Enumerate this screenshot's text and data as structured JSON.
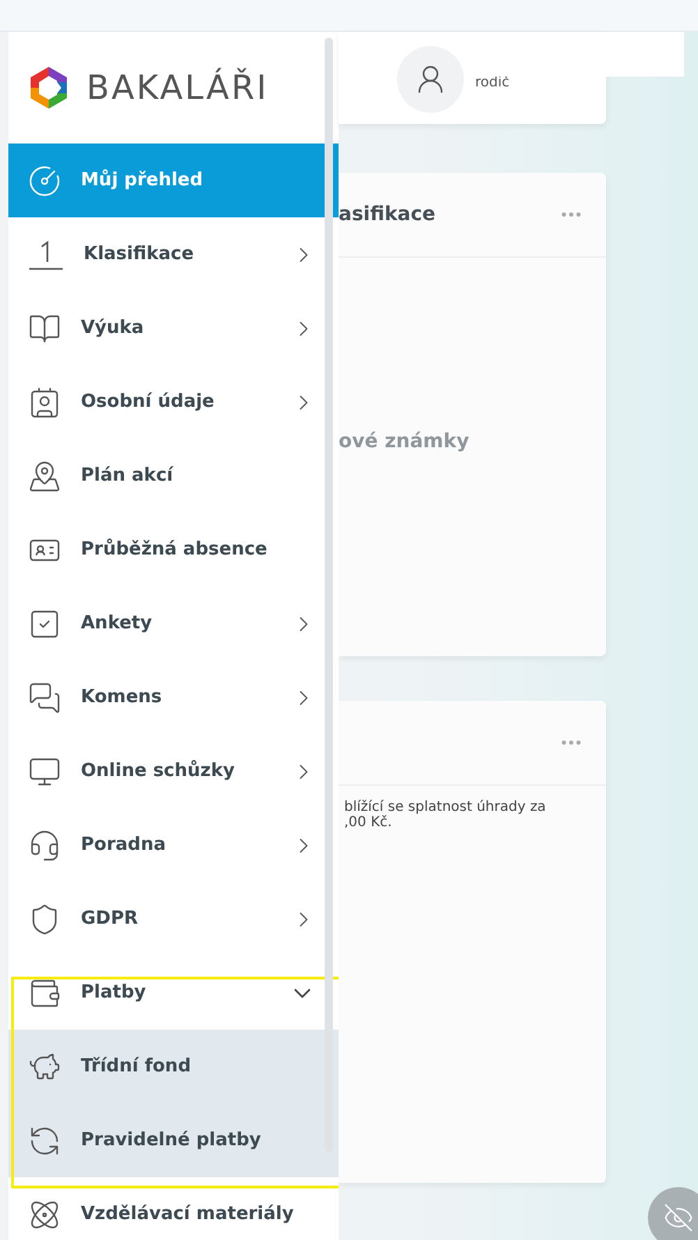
{
  "logo": {
    "text": "BAKALÁŘI"
  },
  "user": {
    "role": "rodič"
  },
  "cards": [
    {
      "title": "asifikace",
      "empty_text": "ové známky"
    },
    {
      "lines": [
        "blížící se splatnost úhrady za",
        ",00 Kč."
      ]
    }
  ],
  "menu": [
    {
      "label": "Můj přehled",
      "selected": true,
      "chevron": false,
      "expanded": false
    },
    {
      "label": "Klasifikace",
      "selected": false,
      "chevron": true,
      "expanded": false
    },
    {
      "label": "Výuka",
      "selected": false,
      "chevron": true,
      "expanded": false
    },
    {
      "label": "Osobní údaje",
      "selected": false,
      "chevron": true,
      "expanded": false
    },
    {
      "label": "Plán akcí",
      "selected": false,
      "chevron": false,
      "expanded": false
    },
    {
      "label": "Průběžná absence",
      "selected": false,
      "chevron": false,
      "expanded": false
    },
    {
      "label": "Ankety",
      "selected": false,
      "chevron": true,
      "expanded": false
    },
    {
      "label": "Komens",
      "selected": false,
      "chevron": true,
      "expanded": false
    },
    {
      "label": "Online schůzky",
      "selected": false,
      "chevron": true,
      "expanded": false
    },
    {
      "label": "Poradna",
      "selected": false,
      "chevron": true,
      "expanded": false
    },
    {
      "label": "GDPR",
      "selected": false,
      "chevron": true,
      "expanded": false
    },
    {
      "label": "Platby",
      "selected": false,
      "chevron": true,
      "expanded": true,
      "highlighted": true,
      "children": [
        {
          "label": "Třídní fond",
          "selected": false
        },
        {
          "label": "Pravidelné platby",
          "selected": false
        }
      ]
    },
    {
      "label": "Vzdělávací materiály",
      "selected": false,
      "chevron": false,
      "expanded": false
    }
  ]
}
